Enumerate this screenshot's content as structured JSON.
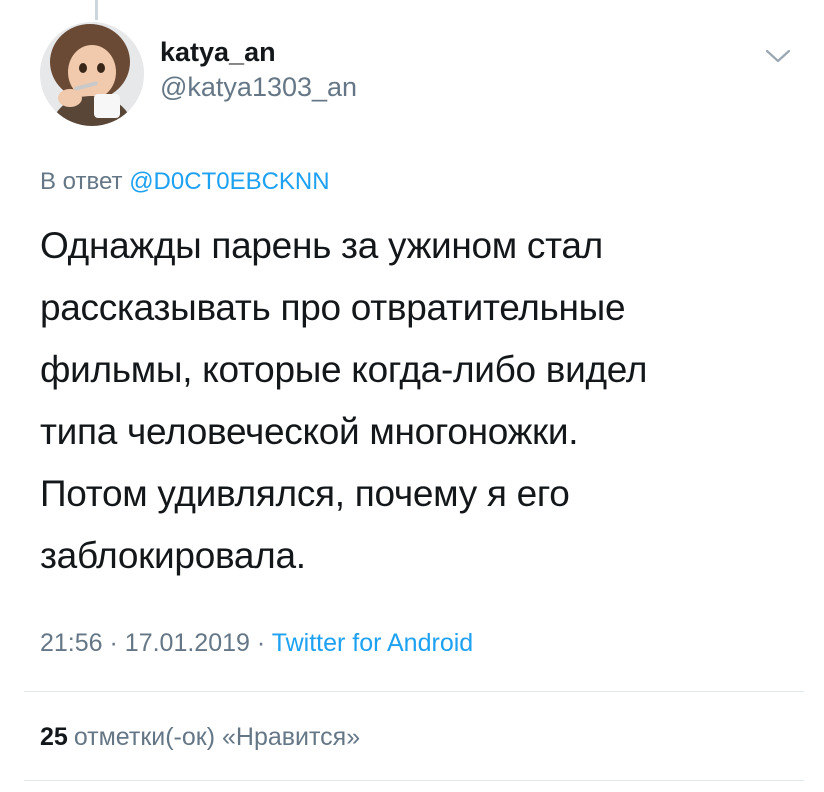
{
  "tweet": {
    "display_name": "katya_an",
    "handle": "@katya1303_an",
    "reply_prefix": "В ответ",
    "reply_to": "@D0CT0EBCKNN",
    "text_lines": [
      "Однажды парень за ужином стал",
      "рассказывать про отвратительные",
      "фильмы, которые когда-либо видел",
      "типа человеческой многоножки.",
      "Потом удивлялся, почему я его",
      "заблокировала."
    ],
    "time": "21:56",
    "separator": "·",
    "date": "17.01.2019",
    "source": "Twitter for Android"
  },
  "stats": {
    "likes_count": "25",
    "likes_label": "отметки(-ок) «Нравится»"
  },
  "colors": {
    "text": "#14171a",
    "secondary": "#657786",
    "link": "#1da1f2",
    "divider": "#e1e8ed"
  },
  "icons": {
    "menu": "chevron-down-icon"
  }
}
